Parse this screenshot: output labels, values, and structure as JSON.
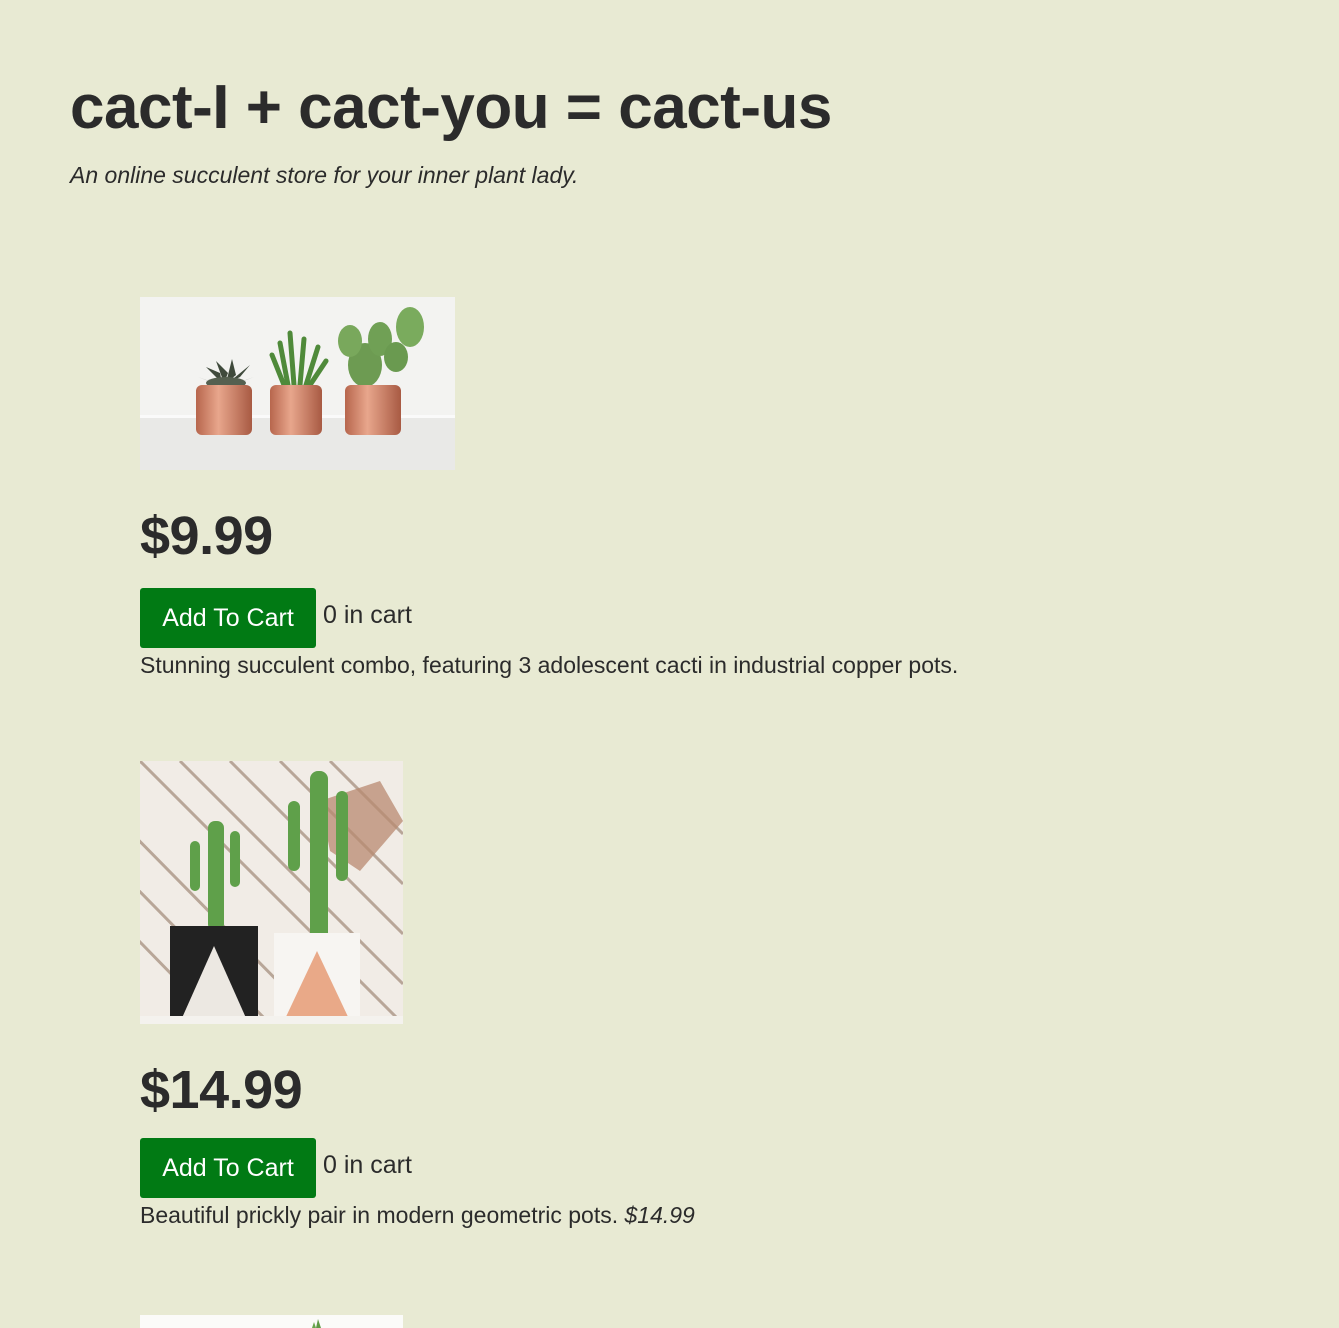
{
  "header": {
    "title": "cact-I + cact-you = cact-us",
    "tagline": "An online succulent store for your inner plant lady."
  },
  "products": [
    {
      "image_icon": "three-cacti-copper-pots-image",
      "price": "$9.99",
      "button_label": "Add To Cart",
      "cart_count": "0 in cart",
      "description": "Stunning succulent combo, featuring 3 adolescent cacti in industrial copper pots.",
      "description_price": ""
    },
    {
      "image_icon": "two-cacti-geometric-pots-image",
      "price": "$14.99",
      "button_label": "Add To Cart",
      "cart_count": "0 in cart",
      "description": "Beautiful prickly pair in modern geometric pots.",
      "description_price": "$14.99"
    },
    {
      "image_icon": "succulent-image"
    }
  ],
  "colors": {
    "background": "#e8ead3",
    "button": "#017a14",
    "text": "#2b2b2b"
  }
}
